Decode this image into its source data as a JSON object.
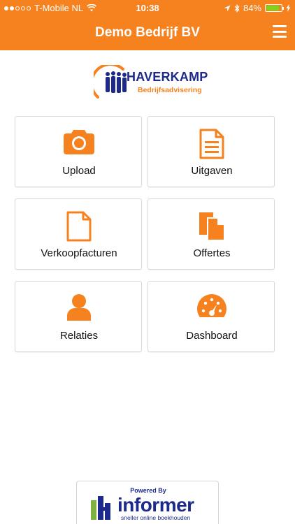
{
  "status_bar": {
    "carrier": "T-Mobile NL",
    "time": "10:38",
    "battery_percent": "84%",
    "battery_level": 0.84,
    "signal_bars_filled": 2,
    "signal_bars_total": 5
  },
  "navbar": {
    "title": "Demo Bedrijf BV",
    "menu_icon": "hamburger-icon"
  },
  "logo": {
    "name": "HAVERKAMP",
    "subtitle": "Bedrijfsadvisering"
  },
  "tiles": [
    {
      "label": "Upload",
      "icon": "camera-icon"
    },
    {
      "label": "Uitgaven",
      "icon": "document-lines-icon"
    },
    {
      "label": "Verkoopfacturen",
      "icon": "document-outline-icon"
    },
    {
      "label": "Offertes",
      "icon": "documents-icon"
    },
    {
      "label": "Relaties",
      "icon": "user-icon"
    },
    {
      "label": "Dashboard",
      "icon": "gauge-icon"
    }
  ],
  "footer": {
    "powered_by": "Powered By",
    "brand": "informer",
    "tagline": "sneller online boekhouden"
  },
  "colors": {
    "accent": "#f5821f",
    "brand_blue": "#1d2a8c"
  }
}
